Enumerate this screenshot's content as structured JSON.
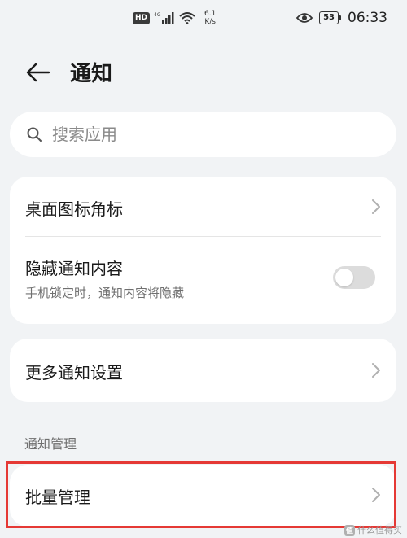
{
  "status_bar": {
    "hd": "HD",
    "signal_label": "4G",
    "speed_value": "6.1",
    "speed_unit": "K/s",
    "battery": "53",
    "time": "06:33"
  },
  "header": {
    "title": "通知"
  },
  "search": {
    "placeholder": "搜索应用"
  },
  "card1": {
    "badge_label": "桌面图标角标",
    "hide_label": "隐藏通知内容",
    "hide_sub": "手机锁定时，通知内容将隐藏",
    "hide_toggle_on": false
  },
  "card2": {
    "more_label": "更多通知设置"
  },
  "section": {
    "title": "通知管理"
  },
  "card3": {
    "batch_label": "批量管理"
  },
  "watermark": {
    "badge": "值",
    "text": "什么值得买"
  },
  "colors": {
    "background": "#f1f3f5",
    "card": "#ffffff",
    "highlight": "#e53935",
    "toggle_off": "#dcdcdc"
  }
}
